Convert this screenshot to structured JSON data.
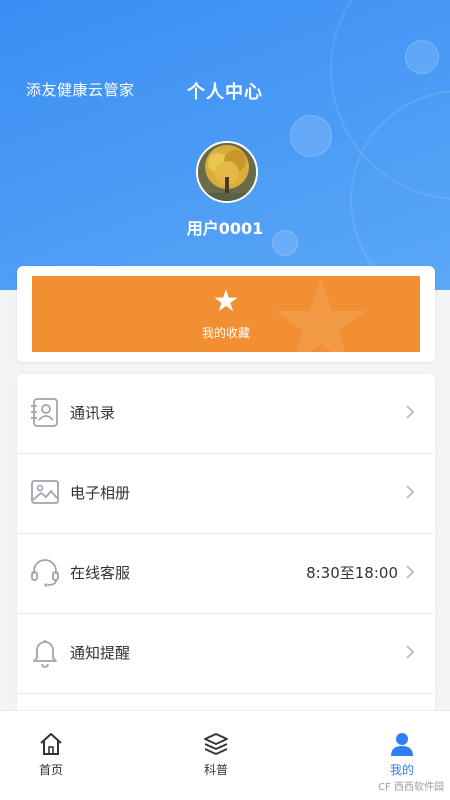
{
  "header": {
    "app_name": "添友健康云管家",
    "title": "个人中心",
    "username": "用户0001",
    "avatar_icon": "avatar-photo"
  },
  "favorites": {
    "label": "我的收藏",
    "icon": "star-icon",
    "color": "#f18f32"
  },
  "menu": {
    "items": [
      {
        "label": "通讯录",
        "icon": "contacts-book-icon",
        "value": ""
      },
      {
        "label": "电子相册",
        "icon": "photo-album-icon",
        "value": ""
      },
      {
        "label": "在线客服",
        "icon": "headset-icon",
        "value": "8:30至18:00"
      },
      {
        "label": "通知提醒",
        "icon": "bell-icon",
        "value": ""
      }
    ]
  },
  "tabbar": {
    "tabs": [
      {
        "label": "首页",
        "icon": "home-icon",
        "active": false
      },
      {
        "label": "科普",
        "icon": "layers-icon",
        "active": false
      },
      {
        "label": "我的",
        "icon": "user-icon",
        "active": true
      }
    ],
    "active_color": "#2f7ff0"
  },
  "watermark": "CF 西西软件园"
}
